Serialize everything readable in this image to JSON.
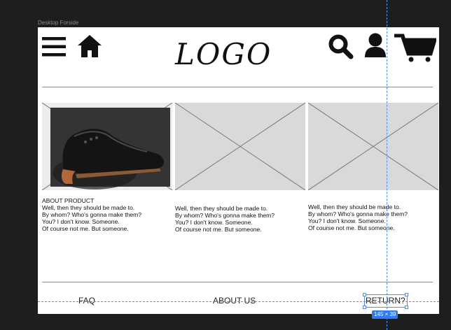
{
  "canvas": {
    "frame_label": "Desktop Forside",
    "accent_color": "#4a90ff",
    "placeholder_color": "#d9d9d9"
  },
  "header": {
    "logo_text": "LOGO",
    "icons": [
      "menu-icon",
      "home-icon",
      "search-icon",
      "user-icon",
      "cart-icon"
    ]
  },
  "products": [
    {
      "image": "shoe-photo",
      "title": "ABOUT PRODUCT",
      "description": "Well, then they should be made to.\nBy whom? Who's gonna make them?\nYou? I don't know. Someone.\nOf course not me. But someone."
    },
    {
      "image": "placeholder",
      "title": "",
      "description": "Well, then they should be made to.\nBy whom? Who's gonna make them?\nYou? I don't know. Someone.\nOf course not me. But someone."
    },
    {
      "image": "placeholder",
      "title": "",
      "description": "Well, then they should be made to.\nBy whom? Who's gonna make them?\nYou? I don't know. Someone.\nOf course not me. But someone."
    }
  ],
  "footer": {
    "links": [
      "FAQ",
      "ABOUT US",
      "RETURN?"
    ]
  },
  "selection": {
    "size_label": "145 × 39"
  }
}
